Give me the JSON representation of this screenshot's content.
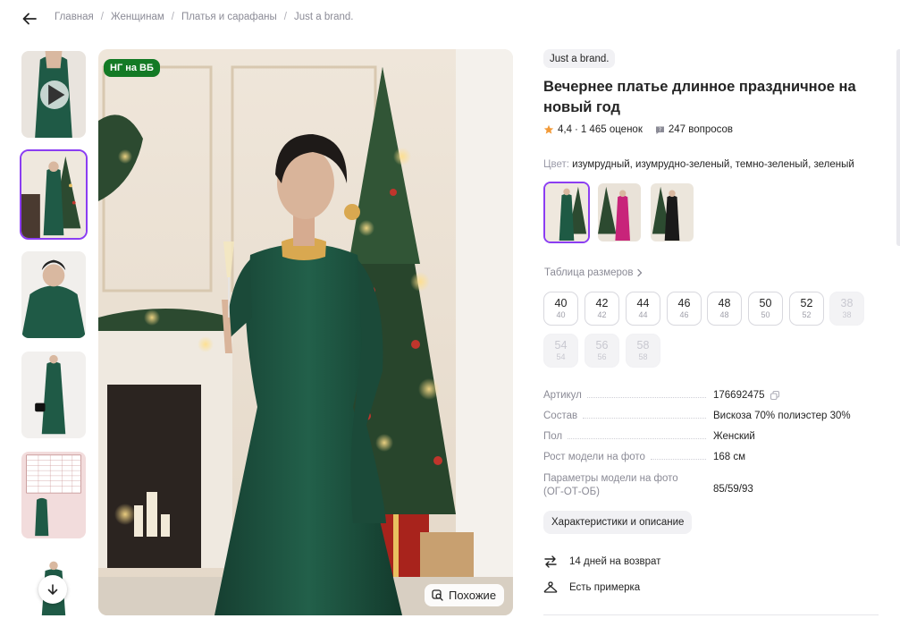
{
  "breadcrumb": {
    "items": [
      "Главная",
      "Женщинам",
      "Платья и сарафаны",
      "Just a brand."
    ]
  },
  "gallery": {
    "badge": "НГ на ВБ",
    "similar_label": "Похожие"
  },
  "product": {
    "brand": "Just a brand.",
    "title": "Вечернее платье длинное праздничное на новый год",
    "rating": "4,4",
    "reviews": "1 465 оценок",
    "questions": "247 вопросов",
    "color_label": "Цвет:",
    "color_value": "изумрудный, изумрудно-зеленый, темно-зеленый, зеленый",
    "colors": [
      "#1e5a44",
      "#c8247a",
      "#1a1a1a"
    ],
    "size_table_label": "Таблица размеров",
    "sizes": [
      {
        "main": "40",
        "sub": "40",
        "available": true
      },
      {
        "main": "42",
        "sub": "42",
        "available": true
      },
      {
        "main": "44",
        "sub": "44",
        "available": true
      },
      {
        "main": "46",
        "sub": "46",
        "available": true
      },
      {
        "main": "48",
        "sub": "48",
        "available": true
      },
      {
        "main": "50",
        "sub": "50",
        "available": true
      },
      {
        "main": "52",
        "sub": "52",
        "available": true
      },
      {
        "main": "38",
        "sub": "38",
        "available": false
      },
      {
        "main": "54",
        "sub": "54",
        "available": false
      },
      {
        "main": "56",
        "sub": "56",
        "available": false
      },
      {
        "main": "58",
        "sub": "58",
        "available": false
      }
    ],
    "specs": [
      {
        "key": "Артикул",
        "value": "176692475",
        "copy": true
      },
      {
        "key": "Состав",
        "value": "Вискоза 70% полиэстер 30%"
      },
      {
        "key": "Пол",
        "value": "Женский"
      },
      {
        "key": "Рост модели на фото",
        "value": "168 см"
      },
      {
        "key": "Параметры модели на фото",
        "key2": "(ОГ-ОТ-ОБ)",
        "value": "85/59/93"
      }
    ],
    "characteristics_label": "Характеристики и описание",
    "perks": {
      "return": "14 дней на возврат",
      "fitting": "Есть примерка"
    }
  },
  "colors": {
    "accent": "#8b3df2",
    "badge": "#137a25",
    "star": "#f29a38"
  }
}
